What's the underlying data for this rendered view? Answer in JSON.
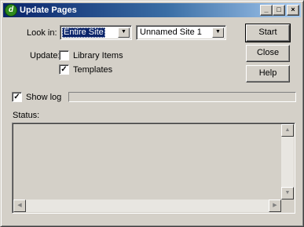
{
  "window": {
    "title": "Update Pages",
    "app_icon_glyph": "d",
    "controls": {
      "minimize": "_",
      "maximize": "□",
      "close": "×"
    }
  },
  "look_in": {
    "label": "Look in:",
    "scope_value": "Entire Site",
    "site_value": "Unnamed Site 1"
  },
  "update": {
    "label": "Update:",
    "library_items": {
      "label": "Library Items",
      "checked": false
    },
    "templates": {
      "label": "Templates",
      "checked": true
    }
  },
  "buttons": {
    "start": "Start",
    "close": "Close",
    "help": "Help"
  },
  "show_log": {
    "label": "Show log",
    "checked": true
  },
  "progress": {
    "fraction": 0
  },
  "status": {
    "label": "Status:",
    "text": ""
  },
  "icons": {
    "dropdown": "▼",
    "scroll_up": "▲",
    "scroll_down": "▼",
    "scroll_left": "◀",
    "scroll_right": "▶",
    "check": "✓"
  },
  "colors": {
    "titlebar_start": "#0a246a",
    "titlebar_end": "#a6caf0",
    "selection": "#0a246a",
    "face": "#d4d0c8"
  }
}
